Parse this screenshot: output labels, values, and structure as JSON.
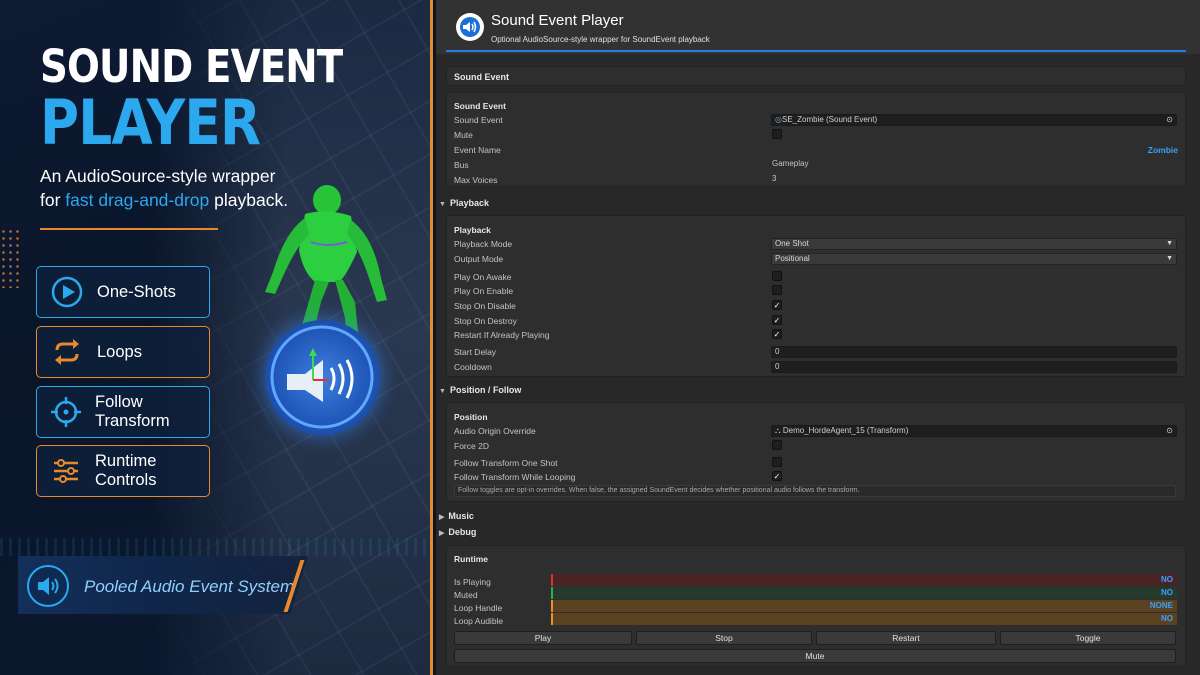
{
  "promo": {
    "title_line1": "SOUND EVENT",
    "title_line2": "PLAYER",
    "subtitle_line1": "An AudioSource-style wrapper",
    "subtitle_pre": "for ",
    "subtitle_highlight": "fast drag-and-drop",
    "subtitle_post": " playback.",
    "features": [
      {
        "label": "One-Shots",
        "icon": "play-icon",
        "color": "#2ba8ee"
      },
      {
        "label": "Loops",
        "icon": "loop-icon",
        "color": "#e8892b"
      },
      {
        "label": "Follow Transform",
        "icon": "crosshair-icon",
        "color": "#2ba8ee"
      },
      {
        "label": "Runtime Controls",
        "icon": "sliders-icon",
        "color": "#e8892b"
      }
    ],
    "footer_label": "Pooled Audio Event System",
    "accent_blue": "#2ba8ee",
    "accent_orange": "#e8892b"
  },
  "inspector": {
    "title": "Sound Event Player",
    "subtitle": "Optional AudioSource-style wrapper for SoundEvent playback",
    "sound_event_section": {
      "header": "Sound Event",
      "group": "Sound Event",
      "sound_event_label": "Sound Event",
      "sound_event_value": "SE_Zombie (Sound Event)",
      "mute_label": "Mute",
      "event_name_label": "Event Name",
      "event_name_value": "Zombie",
      "bus_label": "Bus",
      "bus_value": "Gameplay",
      "max_voices_label": "Max Voices",
      "max_voices_value": "3"
    },
    "playback": {
      "header": "Playback",
      "group": "Playback",
      "playback_mode_label": "Playback Mode",
      "playback_mode_value": "One Shot",
      "output_mode_label": "Output Mode",
      "output_mode_value": "Positional",
      "play_on_awake_label": "Play On Awake",
      "play_on_enable_label": "Play On Enable",
      "stop_on_disable_label": "Stop On Disable",
      "stop_on_destroy_label": "Stop On Destroy",
      "restart_label": "Restart If Already Playing",
      "start_delay_label": "Start Delay",
      "start_delay_value": "0",
      "cooldown_label": "Cooldown",
      "cooldown_value": "0",
      "check_mark": "✓"
    },
    "position": {
      "header": "Position / Follow",
      "group": "Position",
      "origin_label": "Audio Origin Override",
      "origin_value": "Demo_HordeAgent_15 (Transform)",
      "force2d_label": "Force 2D",
      "follow_one_shot_label": "Follow Transform One Shot",
      "follow_looping_label": "Follow Transform While Looping",
      "hint": "Follow toggles are opt-in overrides. When false, the assigned SoundEvent decides whether positional audio follows the transform."
    },
    "music_header": "Music",
    "debug_header": "Debug",
    "runtime": {
      "header": "Runtime",
      "is_playing_label": "Is Playing",
      "is_playing_value": "NO",
      "muted_label": "Muted",
      "muted_value": "NO",
      "loop_handle_label": "Loop Handle",
      "loop_handle_value": "NONE",
      "loop_audible_label": "Loop Audible",
      "loop_audible_value": "NO",
      "play_button": "Play",
      "stop_button": "Stop",
      "restart_button": "Restart",
      "toggle_button": "Toggle",
      "mute_button": "Mute"
    }
  }
}
